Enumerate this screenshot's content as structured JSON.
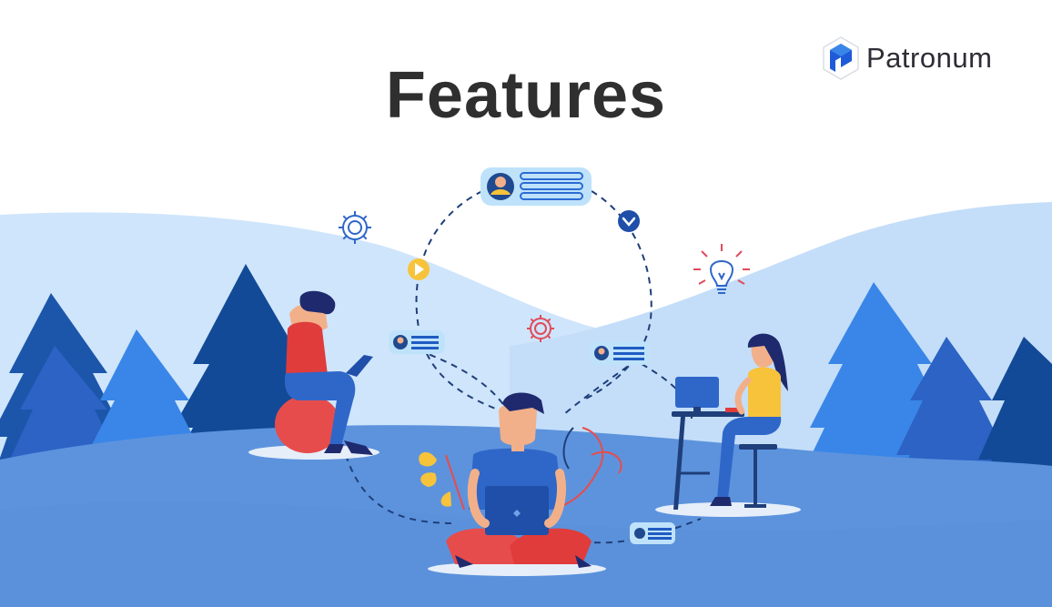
{
  "page": {
    "title": "Features"
  },
  "brand": {
    "name": "Patronum",
    "mark_icon": "patronum-logo-icon"
  },
  "colors": {
    "sky_hill": "#cfe5fb",
    "far_hill": "#bcd9f6",
    "ground": "#5d93dd",
    "ground_dark": "#4d82d1",
    "tree_dark": "#124a97",
    "tree_mid": "#2c63c4",
    "tree_light": "#3a86e8",
    "accent_red": "#e74c4c",
    "accent_yellow": "#f7c33b",
    "person_blue": "#2f67c9",
    "chip": "#bfe2fb"
  },
  "icons": [
    "gear-icon",
    "lightbulb-icon",
    "play-icon",
    "chevron-down-icon",
    "chat-bubble-icon",
    "laptop-icon",
    "person-icon"
  ]
}
